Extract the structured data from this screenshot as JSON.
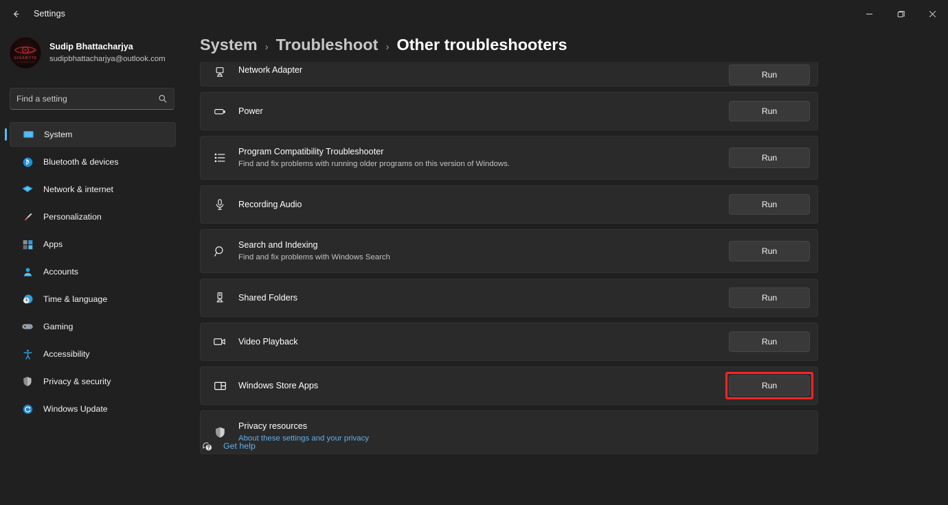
{
  "titlebar": {
    "back_icon": "arrow-left-icon",
    "app_title": "Settings",
    "minimize_label": "–",
    "maximize_label": "❐",
    "close_label": "✕"
  },
  "sidebar": {
    "profile": {
      "name": "Sudip Bhattacharjya",
      "email": "sudipbhattacharjya@outlook.com",
      "avatar_brand": "GIGABYTE",
      "avatar_brand_sub": "TECHNOLOGY"
    },
    "search": {
      "placeholder": "Find a setting",
      "value": "",
      "icon": "search-icon"
    },
    "items": [
      {
        "label": "System",
        "icon": "display-icon",
        "active": true
      },
      {
        "label": "Bluetooth & devices",
        "icon": "bluetooth-icon",
        "active": false
      },
      {
        "label": "Network & internet",
        "icon": "wifi-icon",
        "active": false
      },
      {
        "label": "Personalization",
        "icon": "paintbrush-icon",
        "active": false
      },
      {
        "label": "Apps",
        "icon": "apps-grid-icon",
        "active": false
      },
      {
        "label": "Accounts",
        "icon": "person-icon",
        "active": false
      },
      {
        "label": "Time & language",
        "icon": "clock-globe-icon",
        "active": false
      },
      {
        "label": "Gaming",
        "icon": "gamepad-icon",
        "active": false
      },
      {
        "label": "Accessibility",
        "icon": "accessibility-icon",
        "active": false
      },
      {
        "label": "Privacy & security",
        "icon": "shield-icon",
        "active": false
      },
      {
        "label": "Windows Update",
        "icon": "update-icon",
        "active": false
      }
    ]
  },
  "breadcrumb": {
    "root": "System",
    "sep1": "›",
    "middle": "Troubleshoot",
    "sep2": "›",
    "current": "Other troubleshooters"
  },
  "troubleshooters": [
    {
      "title": "Network Adapter",
      "subtitle": "",
      "icon": "monitor-network-icon",
      "action": "Run",
      "clipped": true,
      "highlighted": false
    },
    {
      "title": "Power",
      "subtitle": "",
      "icon": "battery-icon",
      "action": "Run",
      "clipped": false,
      "highlighted": false
    },
    {
      "title": "Program Compatibility Troubleshooter",
      "subtitle": "Find and fix problems with running older programs on this version of Windows.",
      "icon": "list-icon",
      "action": "Run",
      "clipped": false,
      "highlighted": false
    },
    {
      "title": "Recording Audio",
      "subtitle": "",
      "icon": "microphone-icon",
      "action": "Run",
      "clipped": false,
      "highlighted": false
    },
    {
      "title": "Search and Indexing",
      "subtitle": "Find and fix problems with Windows Search",
      "icon": "magnifier-icon",
      "action": "Run",
      "clipped": false,
      "highlighted": false
    },
    {
      "title": "Shared Folders",
      "subtitle": "",
      "icon": "server-icon",
      "action": "Run",
      "clipped": false,
      "highlighted": false
    },
    {
      "title": "Video Playback",
      "subtitle": "",
      "icon": "camcorder-icon",
      "action": "Run",
      "clipped": false,
      "highlighted": false
    },
    {
      "title": "Windows Store Apps",
      "subtitle": "",
      "icon": "store-apps-icon",
      "action": "Run",
      "clipped": false,
      "highlighted": true
    }
  ],
  "privacy": {
    "title": "Privacy resources",
    "link": "About these settings and your privacy",
    "icon": "shield-icon"
  },
  "get_help": {
    "label": "Get help",
    "icon": "help-bubble-icon"
  },
  "colors": {
    "accent": "#4cc2ff",
    "link": "#5fb2e8",
    "highlight": "#ff2323",
    "window_bg": "#202020",
    "card_bg": "#2b2a2b",
    "button_bg": "#393939"
  }
}
